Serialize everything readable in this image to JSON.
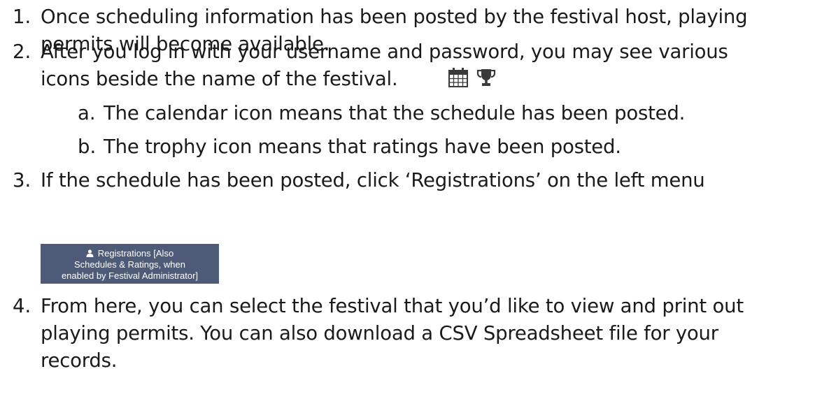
{
  "items": [
    {
      "number": "1.",
      "lines": [
        "Once scheduling information has been posted by the festival host, playing",
        "permits will become available."
      ]
    },
    {
      "number": "2.",
      "lines": [
        "After you log in with your username and password, you may see various",
        "icons beside the name of the festival."
      ],
      "icons": [
        "calendar-icon",
        "trophy-icon"
      ],
      "subitems": [
        {
          "letter": "a.",
          "text": "The calendar icon means that the schedule has been posted."
        },
        {
          "letter": "b.",
          "text": "The trophy icon means that ratings have been posted."
        }
      ]
    },
    {
      "number": "3.",
      "lines": [
        "If the schedule has been posted, click ‘Registrations’ on the left menu"
      ],
      "menu_button": {
        "icon": "user-icon",
        "line1": "Registrations [Also",
        "line2": "Schedules & Ratings, when",
        "line3": "enabled by Festival Administrator]",
        "background": "#4d5b78",
        "text_color": "#ffffff"
      }
    },
    {
      "number": "4.",
      "lines": [
        "From here, you can select the festival that you’d like to view and print out",
        "playing permits.  You can also download a CSV Spreadsheet file for your",
        "records."
      ]
    }
  ]
}
